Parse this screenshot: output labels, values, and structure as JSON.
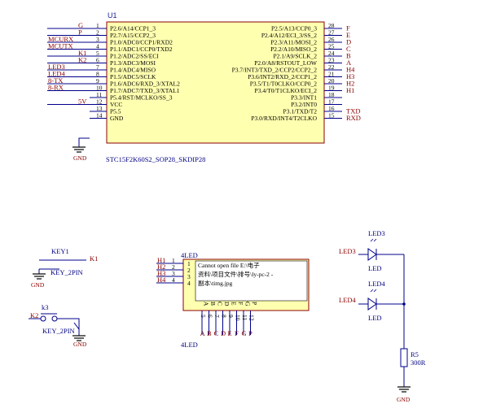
{
  "u1": {
    "designator": "U1",
    "part": "STC15F2K60S2_SOP28_SKDIP28",
    "left_pins": [
      {
        "num": "1",
        "name": "P2.6/A14/CCP1_3",
        "net": "G"
      },
      {
        "num": "2",
        "name": "P2.7/A15/CCP2_3",
        "net": "P"
      },
      {
        "num": "3",
        "name": "P1.0/ADC0/CCP1/RXD2",
        "net": "MCURX"
      },
      {
        "num": "4",
        "name": "P1.1/ADC1/CCP0/TXD2",
        "net": "MCUTX"
      },
      {
        "num": "5",
        "name": "P1.2/ADC2/SS/ECI",
        "net": "K1"
      },
      {
        "num": "6",
        "name": "P1.3/ADC3/MOSI",
        "net": "K2"
      },
      {
        "num": "7",
        "name": "P1.4/ADC4/MISO",
        "net": "LED3"
      },
      {
        "num": "8",
        "name": "P1.5/ADC5/SCLK",
        "net": "LED4"
      },
      {
        "num": "9",
        "name": "P1.6/ADC6/RXD_3/XTAL2",
        "net": "8-TX"
      },
      {
        "num": "10",
        "name": "P1.7/ADC7/TXD_3/XTAL1",
        "net": "8-RX"
      },
      {
        "num": "11",
        "name": "P5.4/RST/MCLKO/SS_3",
        "net": ""
      },
      {
        "num": "12",
        "name": "VCC",
        "net": "5V"
      },
      {
        "num": "13",
        "name": "P5.5",
        "net": ""
      },
      {
        "num": "14",
        "name": "GND",
        "net": ""
      }
    ],
    "right_pins": [
      {
        "num": "28",
        "name": "P2.5/A13/CCP0_3",
        "net": "F"
      },
      {
        "num": "27",
        "name": "P2.4/A12/ECI_3/SS_2",
        "net": "E"
      },
      {
        "num": "26",
        "name": "P2.3/A11/MOSI_2",
        "net": "D"
      },
      {
        "num": "25",
        "name": "P2.2/A10/MISO_2",
        "net": "C"
      },
      {
        "num": "24",
        "name": "P2.1/A9/SCLK_2",
        "net": "B"
      },
      {
        "num": "23",
        "name": "P2.0/A8/RSTOUT_LOW",
        "net": "A"
      },
      {
        "num": "22",
        "name": "P3.7/INT3/TXD_2/CCP2/CCP2_2",
        "net": "H4"
      },
      {
        "num": "21",
        "name": "P3.6/INT2/RXD_2/CCP1_2",
        "net": "H3"
      },
      {
        "num": "20",
        "name": "P3.5/T1/T0CLKO/CCP0_2",
        "net": "H2"
      },
      {
        "num": "19",
        "name": "P3.4/T0/T1CLKO/ECI_2",
        "net": "H1"
      },
      {
        "num": "18",
        "name": "P3.3/INT1",
        "net": ""
      },
      {
        "num": "17",
        "name": "P3.2/INT0",
        "net": ""
      },
      {
        "num": "16",
        "name": "P3.1/TXD/T2",
        "net": "TXD"
      },
      {
        "num": "15",
        "name": "P3.0/RXD/INT4/T2CLKO",
        "net": "RXD"
      }
    ],
    "gnd_label": "GND"
  },
  "key1": {
    "designator": "KEY1",
    "part": "KEY_2PIN",
    "net": "K1",
    "gnd_label": "GND"
  },
  "k3": {
    "designator": "k3",
    "part": "KEY_2PIN",
    "net": "K2",
    "gnd_label": "GND"
  },
  "led_module": {
    "designator": "4LED",
    "part": "4LED",
    "error_lines": [
      "Cannot open file E:\\电子",
      "资料\\项目文件\\排号\\ly-pc-2 -",
      "副本\\timg.jpg"
    ],
    "left_pins": [
      {
        "num": "1",
        "net": "H1"
      },
      {
        "num": "2",
        "net": "H2"
      },
      {
        "num": "3",
        "net": "H3"
      },
      {
        "num": "4",
        "net": "H4"
      }
    ],
    "bottom_pins": [
      {
        "name": "A",
        "num": "5",
        "net": "A"
      },
      {
        "name": "B",
        "num": "6",
        "net": "B"
      },
      {
        "name": "C",
        "num": "7",
        "net": "C"
      },
      {
        "name": "D",
        "num": "8",
        "net": "D"
      },
      {
        "name": "E",
        "num": "9",
        "net": "E"
      },
      {
        "name": "F",
        "num": "10",
        "net": "F"
      },
      {
        "name": "G",
        "num": "11",
        "net": "G"
      },
      {
        "name": "P",
        "num": "12",
        "net": "P"
      }
    ]
  },
  "leds": [
    {
      "designator": "LED3",
      "part": "LED",
      "net": "LED3"
    },
    {
      "designator": "LED4",
      "part": "LED",
      "net": "LED4"
    }
  ],
  "r5": {
    "designator": "R5",
    "value": "300R",
    "gnd_label": "GND"
  },
  "colors": {
    "wire": "#00008b",
    "part_outline": "#8b0000",
    "part_fill": "#ffffb0",
    "net_label": "#8b0000",
    "designator": "#1a1a9a"
  }
}
